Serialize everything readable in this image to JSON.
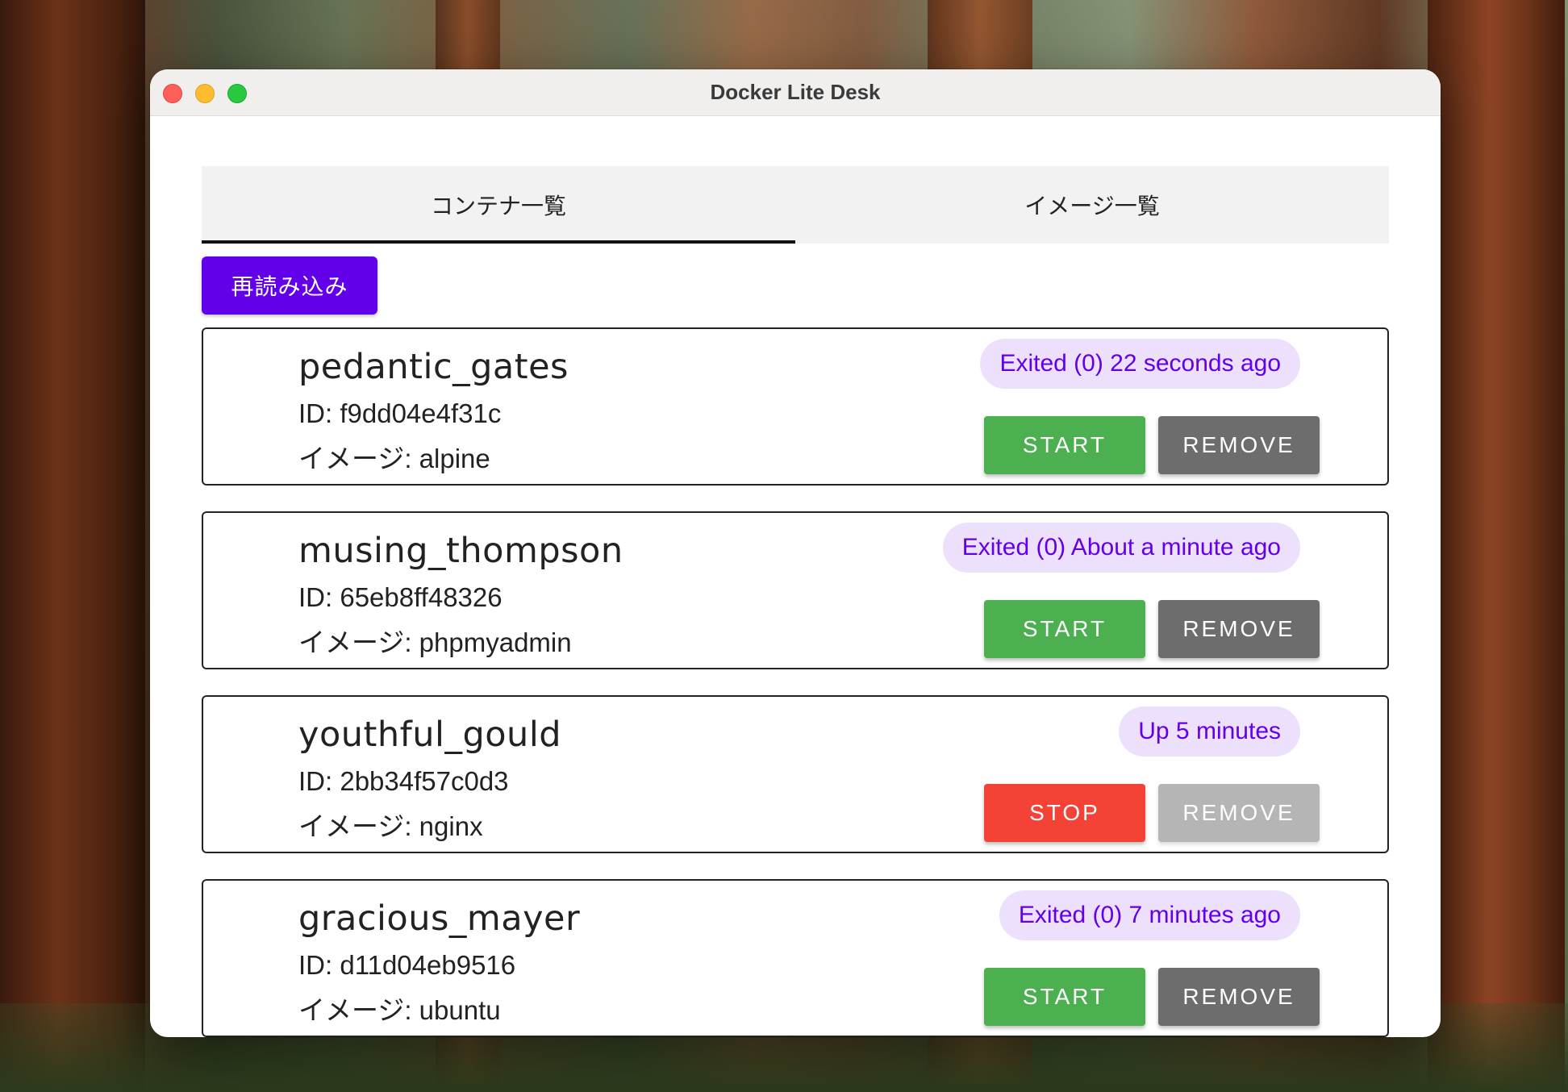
{
  "window": {
    "title": "Docker Lite Desk"
  },
  "tabs": [
    {
      "label": "コンテナ一覧",
      "active": true
    },
    {
      "label": "イメージ一覧",
      "active": false
    }
  ],
  "toolbar": {
    "reload_label": "再読み込み"
  },
  "containers": [
    {
      "name": "pedantic_gates",
      "id": "ID: f9dd04e4f31c",
      "image": "イメージ: alpine",
      "status": "Exited (0) 22 seconds ago",
      "primary_action": "START",
      "remove_label": "REMOVE",
      "remove_disabled": false
    },
    {
      "name": "musing_thompson",
      "id": "ID: 65eb8ff48326",
      "image": "イメージ: phpmyadmin",
      "status": "Exited (0) About a minute ago",
      "primary_action": "START",
      "remove_label": "REMOVE",
      "remove_disabled": false
    },
    {
      "name": "youthful_gould",
      "id": "ID: 2bb34f57c0d3",
      "image": "イメージ: nginx",
      "status": "Up 5 minutes",
      "primary_action": "STOP",
      "remove_label": "REMOVE",
      "remove_disabled": true
    },
    {
      "name": "gracious_mayer",
      "id": "ID: d11d04eb9516",
      "image": "イメージ: ubuntu",
      "status": "Exited (0) 7 minutes ago",
      "primary_action": "START",
      "remove_label": "REMOVE",
      "remove_disabled": false
    }
  ],
  "colors": {
    "accent": "#6200ea",
    "start": "#4caf50",
    "stop": "#f44336",
    "remove": "#6d6d6d",
    "remove_disabled": "#b5b5b5",
    "status_bg": "#ede0fd"
  }
}
